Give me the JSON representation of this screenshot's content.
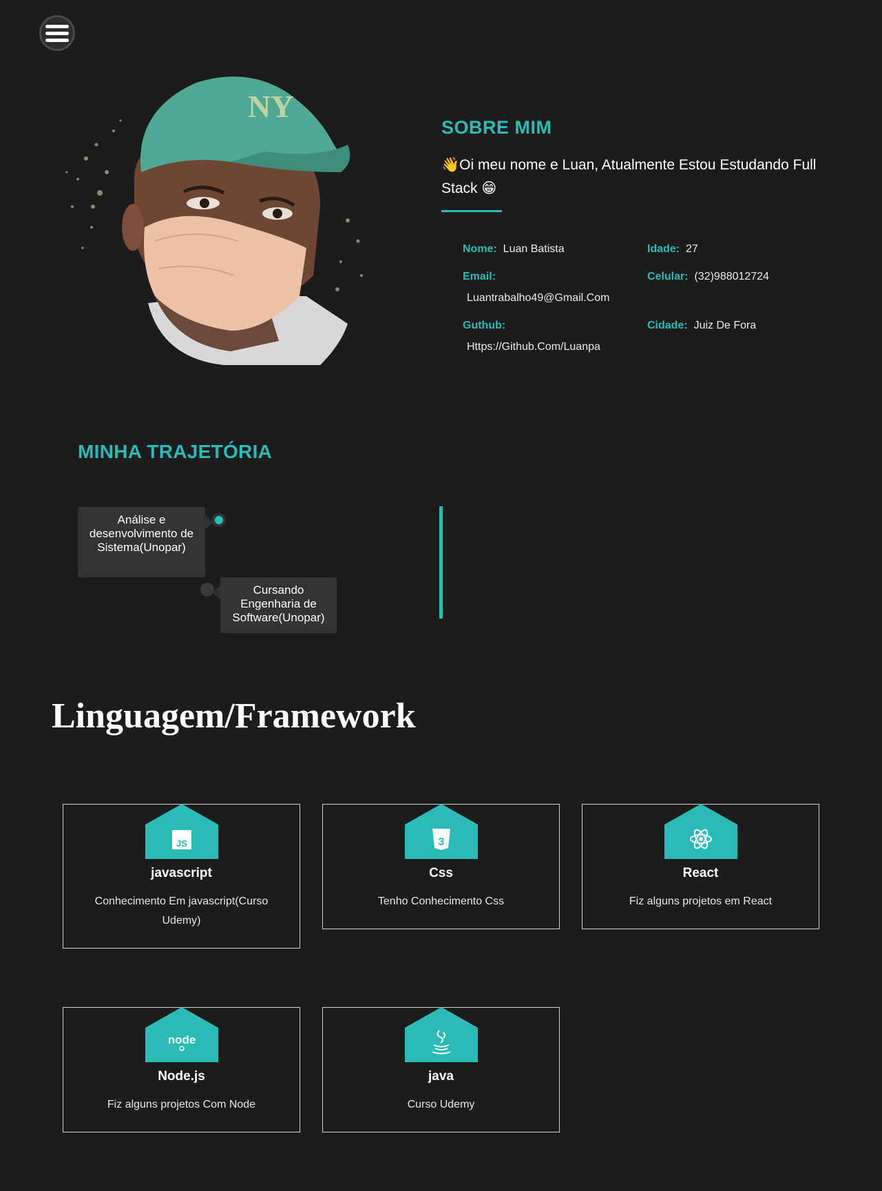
{
  "menu": {
    "icon": "hamburger-menu-icon"
  },
  "about": {
    "title": "SOBRE MIM",
    "intro": "👋Oi meu nome e Luan, Atualmente Estou Estudando Full Stack 😁",
    "info": {
      "nome_label": "Nome:",
      "nome_value": "Luan Batista",
      "idade_label": "Idade:",
      "idade_value": "27",
      "email_label": "Email:",
      "email_value": "Luantrabalho49@Gmail.Com",
      "celular_label": "Celular:",
      "celular_value": "(32)988012724",
      "github_label": "Guthub:",
      "github_value": "Https://Github.Com/Luanpa",
      "cidade_label": "Cidade:",
      "cidade_value": "Juiz De Fora"
    }
  },
  "trajectory": {
    "title": "MINHA TRAJETÓRIA",
    "items": [
      {
        "text": "Análise e desenvolvimento de Sistema(Unopar)"
      },
      {
        "text": "Cursando Engenharia de Software(Unopar)"
      }
    ]
  },
  "languages": {
    "title": "Linguagem/Framework",
    "cards": [
      {
        "name": "javascript",
        "desc": "Conhecimento Em javascript(Curso Udemy)",
        "icon": "javascript-icon"
      },
      {
        "name": "Css",
        "desc": "Tenho Conhecimento Css",
        "icon": "css3-icon"
      },
      {
        "name": "React",
        "desc": "Fiz alguns projetos em React",
        "icon": "react-icon"
      },
      {
        "name": "Node.js",
        "desc": "Fiz alguns projetos Com Node",
        "icon": "nodejs-icon"
      },
      {
        "name": "java",
        "desc": "Curso Udemy",
        "icon": "java-icon"
      }
    ]
  },
  "colors": {
    "accent": "#2bbbb6",
    "background": "#1c1c1c",
    "card_border": "#d0d0d0",
    "timeline_box": "#333333"
  }
}
